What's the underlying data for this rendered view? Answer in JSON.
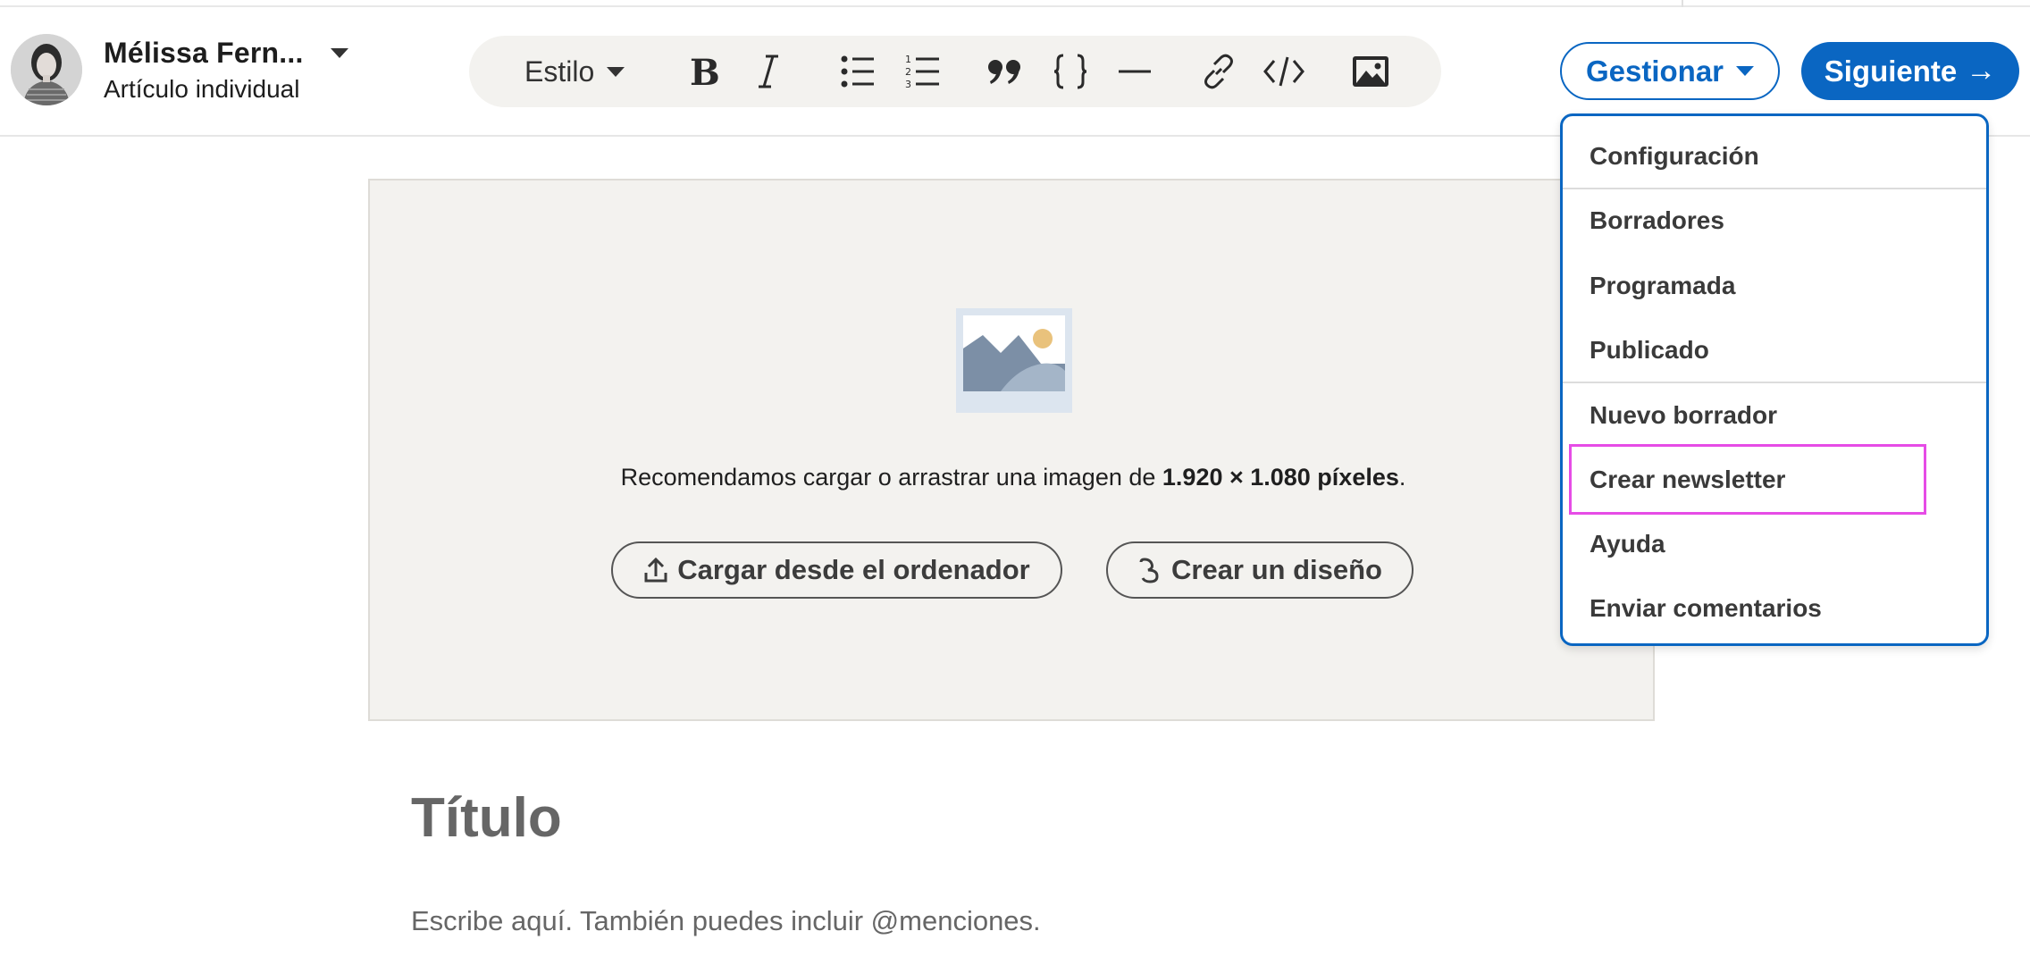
{
  "author": {
    "name": "Mélissa Fern...",
    "subtitle": "Artículo individual"
  },
  "toolbar": {
    "style_label": "Estilo",
    "tools": [
      "bold-icon",
      "italic-icon",
      "bulleted-list-icon",
      "numbered-list-icon",
      "quote-icon",
      "code-block-icon",
      "divider-icon",
      "link-icon",
      "embed-icon",
      "image-icon"
    ]
  },
  "actions": {
    "manage_label": "Gestionar",
    "next_label": "Siguiente",
    "next_arrow": "→"
  },
  "cover": {
    "hint_prefix": "Recomendamos cargar o arrastrar una imagen de ",
    "hint_bold": "1.920 × 1.080 píxeles",
    "hint_suffix": ".",
    "upload_label": "Cargar desde el ordenador",
    "design_label": "Crear un diseño"
  },
  "editor": {
    "title_placeholder": "Título",
    "body_placeholder": "Escribe aquí. También puedes incluir @menciones."
  },
  "menu": {
    "items": [
      "Configuración",
      "Borradores",
      "Programada",
      "Publicado",
      "Nuevo borrador",
      "Crear newsletter",
      "Ayuda",
      "Enviar comentarios"
    ],
    "highlighted": "Crear newsletter"
  },
  "colors": {
    "accent": "#0a66c2",
    "highlight": "#e64ce6",
    "cover_bg": "#f3f2ef"
  }
}
